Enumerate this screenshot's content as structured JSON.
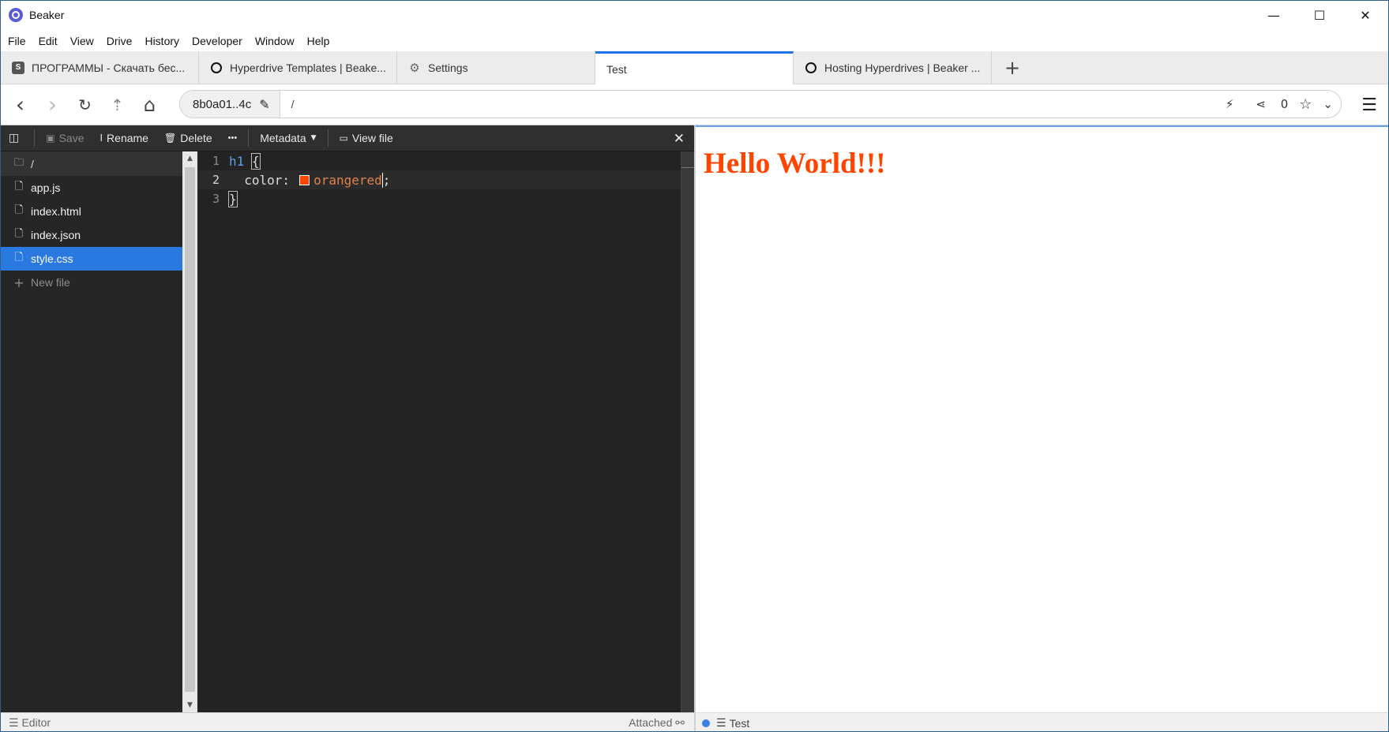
{
  "window": {
    "title": "Beaker",
    "controls": {
      "minimize": "—",
      "maximize": "☐",
      "close": "✕"
    }
  },
  "menu": [
    "File",
    "Edit",
    "View",
    "Drive",
    "History",
    "Developer",
    "Window",
    "Help"
  ],
  "tabs": [
    {
      "label": "ПРОГРАММЫ - Скачать бес...",
      "icon": "programs-favicon",
      "icon_text": "S"
    },
    {
      "label": "Hyperdrive Templates | Beake...",
      "icon": "beaker-ring-icon"
    },
    {
      "label": "Settings",
      "icon": "gear-icon",
      "icon_text": "⚙"
    },
    {
      "label": "Test",
      "icon": "",
      "active": true
    },
    {
      "label": "Hosting Hyperdrives | Beaker ...",
      "icon": "beaker-ring-icon"
    }
  ],
  "tab_add": "+",
  "nav": {
    "back": "‹",
    "forward": "›",
    "reload": "↻",
    "up": "⇡",
    "home": "⌂",
    "site": "8b0a01..4c",
    "path": "/",
    "peers": "0",
    "burger": "☰"
  },
  "toolbar": {
    "save": "Save",
    "rename": "Rename",
    "delete": "Delete",
    "more": "•••",
    "metadata": "Metadata",
    "view_file": "View file",
    "close": "✕"
  },
  "files": {
    "root": "/",
    "items": [
      "app.js",
      "index.html",
      "index.json",
      "style.css"
    ],
    "selected": "style.css",
    "new_file": "New file"
  },
  "code": {
    "lines": [
      {
        "num": "1",
        "selector": "h1",
        "open": "{"
      },
      {
        "num": "2",
        "property": "color:",
        "value": "orangered",
        "end": ";"
      },
      {
        "num": "3",
        "close": "}"
      }
    ],
    "swatch_color": "#ff4500"
  },
  "status": {
    "editor": "Editor",
    "attached": "Attached",
    "preview": "Test"
  },
  "preview": {
    "heading": "Hello World!!!",
    "heading_color": "#ff4500"
  },
  "colors": {
    "accent": "#1f73e8",
    "selected_file": "#2979e0",
    "editor_bg": "#232323"
  }
}
